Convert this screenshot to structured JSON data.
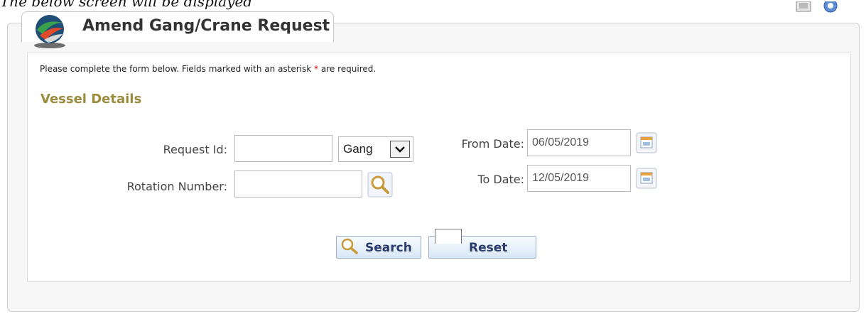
{
  "document": {
    "caption": "The below screen will be displayed"
  },
  "header": {
    "title": "Amend Gang/Crane Request",
    "toolbar_icons": [
      "print-icon",
      "help-icon"
    ]
  },
  "form": {
    "instructions_before": "Please complete the form below. Fields marked with an asterisk ",
    "asterisk": "*",
    "instructions_after": " are required.",
    "section_title": "Vessel Details",
    "request_id": {
      "label": "Request Id:",
      "value": ""
    },
    "type_select": {
      "selected": "Gang"
    },
    "rotation_number": {
      "label": "Rotation Number:",
      "value": ""
    },
    "from_date": {
      "label": "From Date:",
      "value": "06/05/2019"
    },
    "to_date": {
      "label": "To Date:",
      "value": "12/05/2019"
    }
  },
  "actions": {
    "search_label": "Search",
    "reset_label": "Reset"
  },
  "colors": {
    "section_title": "#9a8a3a",
    "asterisk": "#cc0000",
    "button_text": "#2a3a6a"
  }
}
